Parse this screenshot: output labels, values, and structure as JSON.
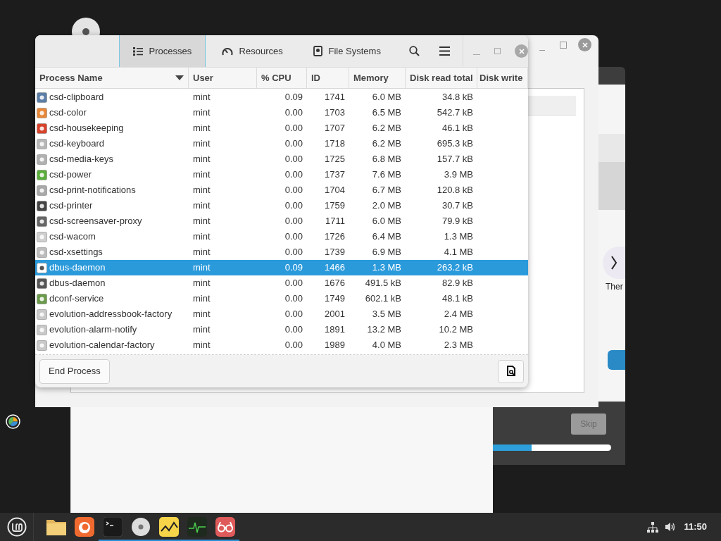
{
  "process_window": {
    "tabs": [
      {
        "label": "Processes",
        "selected": true
      },
      {
        "label": "Resources",
        "selected": false
      },
      {
        "label": "File Systems",
        "selected": false
      }
    ],
    "table": {
      "columns": [
        "Process Name",
        "User",
        "% CPU",
        "ID",
        "Memory",
        "Disk read total",
        "Disk write"
      ],
      "rows": [
        {
          "name": "csd-clipboard",
          "user": "mint",
          "cpu": "0.09",
          "id": "1741",
          "memory": "6.0 MB",
          "disk_read": "34.8 kB",
          "selected": false
        },
        {
          "name": "csd-color",
          "user": "mint",
          "cpu": "0.00",
          "id": "1703",
          "memory": "6.5 MB",
          "disk_read": "542.7 kB",
          "selected": false
        },
        {
          "name": "csd-housekeeping",
          "user": "mint",
          "cpu": "0.00",
          "id": "1707",
          "memory": "6.2 MB",
          "disk_read": "46.1 kB",
          "selected": false
        },
        {
          "name": "csd-keyboard",
          "user": "mint",
          "cpu": "0.00",
          "id": "1718",
          "memory": "6.2 MB",
          "disk_read": "695.3 kB",
          "selected": false
        },
        {
          "name": "csd-media-keys",
          "user": "mint",
          "cpu": "0.00",
          "id": "1725",
          "memory": "6.8 MB",
          "disk_read": "157.7 kB",
          "selected": false
        },
        {
          "name": "csd-power",
          "user": "mint",
          "cpu": "0.00",
          "id": "1737",
          "memory": "7.6 MB",
          "disk_read": "3.9 MB",
          "selected": false
        },
        {
          "name": "csd-print-notifications",
          "user": "mint",
          "cpu": "0.00",
          "id": "1704",
          "memory": "6.7 MB",
          "disk_read": "120.8 kB",
          "selected": false
        },
        {
          "name": "csd-printer",
          "user": "mint",
          "cpu": "0.00",
          "id": "1759",
          "memory": "2.0 MB",
          "disk_read": "30.7 kB",
          "selected": false
        },
        {
          "name": "csd-screensaver-proxy",
          "user": "mint",
          "cpu": "0.00",
          "id": "1711",
          "memory": "6.0 MB",
          "disk_read": "79.9 kB",
          "selected": false
        },
        {
          "name": "csd-wacom",
          "user": "mint",
          "cpu": "0.00",
          "id": "1726",
          "memory": "6.4 MB",
          "disk_read": "1.3 MB",
          "selected": false
        },
        {
          "name": "csd-xsettings",
          "user": "mint",
          "cpu": "0.00",
          "id": "1739",
          "memory": "6.9 MB",
          "disk_read": "4.1 MB",
          "selected": false
        },
        {
          "name": "dbus-daemon",
          "user": "mint",
          "cpu": "0.09",
          "id": "1466",
          "memory": "1.3 MB",
          "disk_read": "263.2 kB",
          "selected": true
        },
        {
          "name": "dbus-daemon",
          "user": "mint",
          "cpu": "0.00",
          "id": "1676",
          "memory": "491.5 kB",
          "disk_read": "82.9 kB",
          "selected": false
        },
        {
          "name": "dconf-service",
          "user": "mint",
          "cpu": "0.00",
          "id": "1749",
          "memory": "602.1 kB",
          "disk_read": "48.1 kB",
          "selected": false
        },
        {
          "name": "evolution-addressbook-factory",
          "user": "mint",
          "cpu": "0.00",
          "id": "2001",
          "memory": "3.5 MB",
          "disk_read": "2.4 MB",
          "selected": false
        },
        {
          "name": "evolution-alarm-notify",
          "user": "mint",
          "cpu": "0.00",
          "id": "1891",
          "memory": "13.2 MB",
          "disk_read": "10.2 MB",
          "selected": false
        },
        {
          "name": "evolution-calendar-factory",
          "user": "mint",
          "cpu": "0.00",
          "id": "1989",
          "memory": "4.0 MB",
          "disk_read": "2.3 MB",
          "selected": false
        }
      ]
    },
    "end_button": "End Process"
  },
  "welcome_window": {
    "item_label": "Ther",
    "skip_button": "Skip",
    "progress": {
      "level": 0.33
    }
  },
  "taskbar": {
    "launchers": [
      {
        "kind": "files",
        "running": false
      },
      {
        "kind": "browser",
        "running": false
      },
      {
        "kind": "terminal",
        "running": true
      },
      {
        "kind": "disc",
        "running": true
      },
      {
        "kind": "chart",
        "running": true
      },
      {
        "kind": "monitor",
        "running": true
      },
      {
        "kind": "glasses",
        "running": true
      }
    ],
    "clock": "11:50"
  }
}
